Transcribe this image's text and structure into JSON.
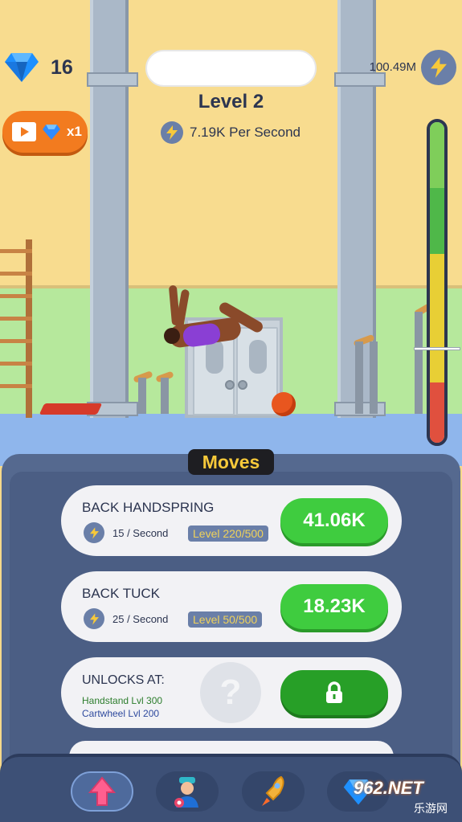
{
  "hud": {
    "gem_count": "16",
    "level_title": "Level 2",
    "per_second": "7.19K Per Second",
    "energy_total": "100.49M",
    "video_reward_multiplier": "x1",
    "meter_fill_fraction": 0.9
  },
  "moves_panel": {
    "title": "Moves",
    "moves": [
      {
        "name": "BACK HANDSPRING",
        "rate": "15 / Second",
        "level": "Level 220/500",
        "price": "41.06K"
      },
      {
        "name": "BACK TUCK",
        "rate": "25 / Second",
        "level": "Level 50/500",
        "price": "18.23K"
      }
    ],
    "locked": {
      "title": "UNLOCKS AT:",
      "requirements": [
        "Handstand Lvl 300",
        "Cartwheel Lvl 200"
      ],
      "placeholder": "?"
    }
  },
  "nav": {
    "items": [
      "upgrade-arrow-icon",
      "trainer-icon",
      "rocket-icon",
      "gem-shop-icon"
    ]
  },
  "watermark": {
    "text": "962.NET",
    "sub": "乐游网"
  },
  "colors": {
    "panel": "#55698f",
    "buy_green": "#3fcc3f",
    "moves_gold": "#f7c93a",
    "accent_orange": "#f27b1f"
  }
}
